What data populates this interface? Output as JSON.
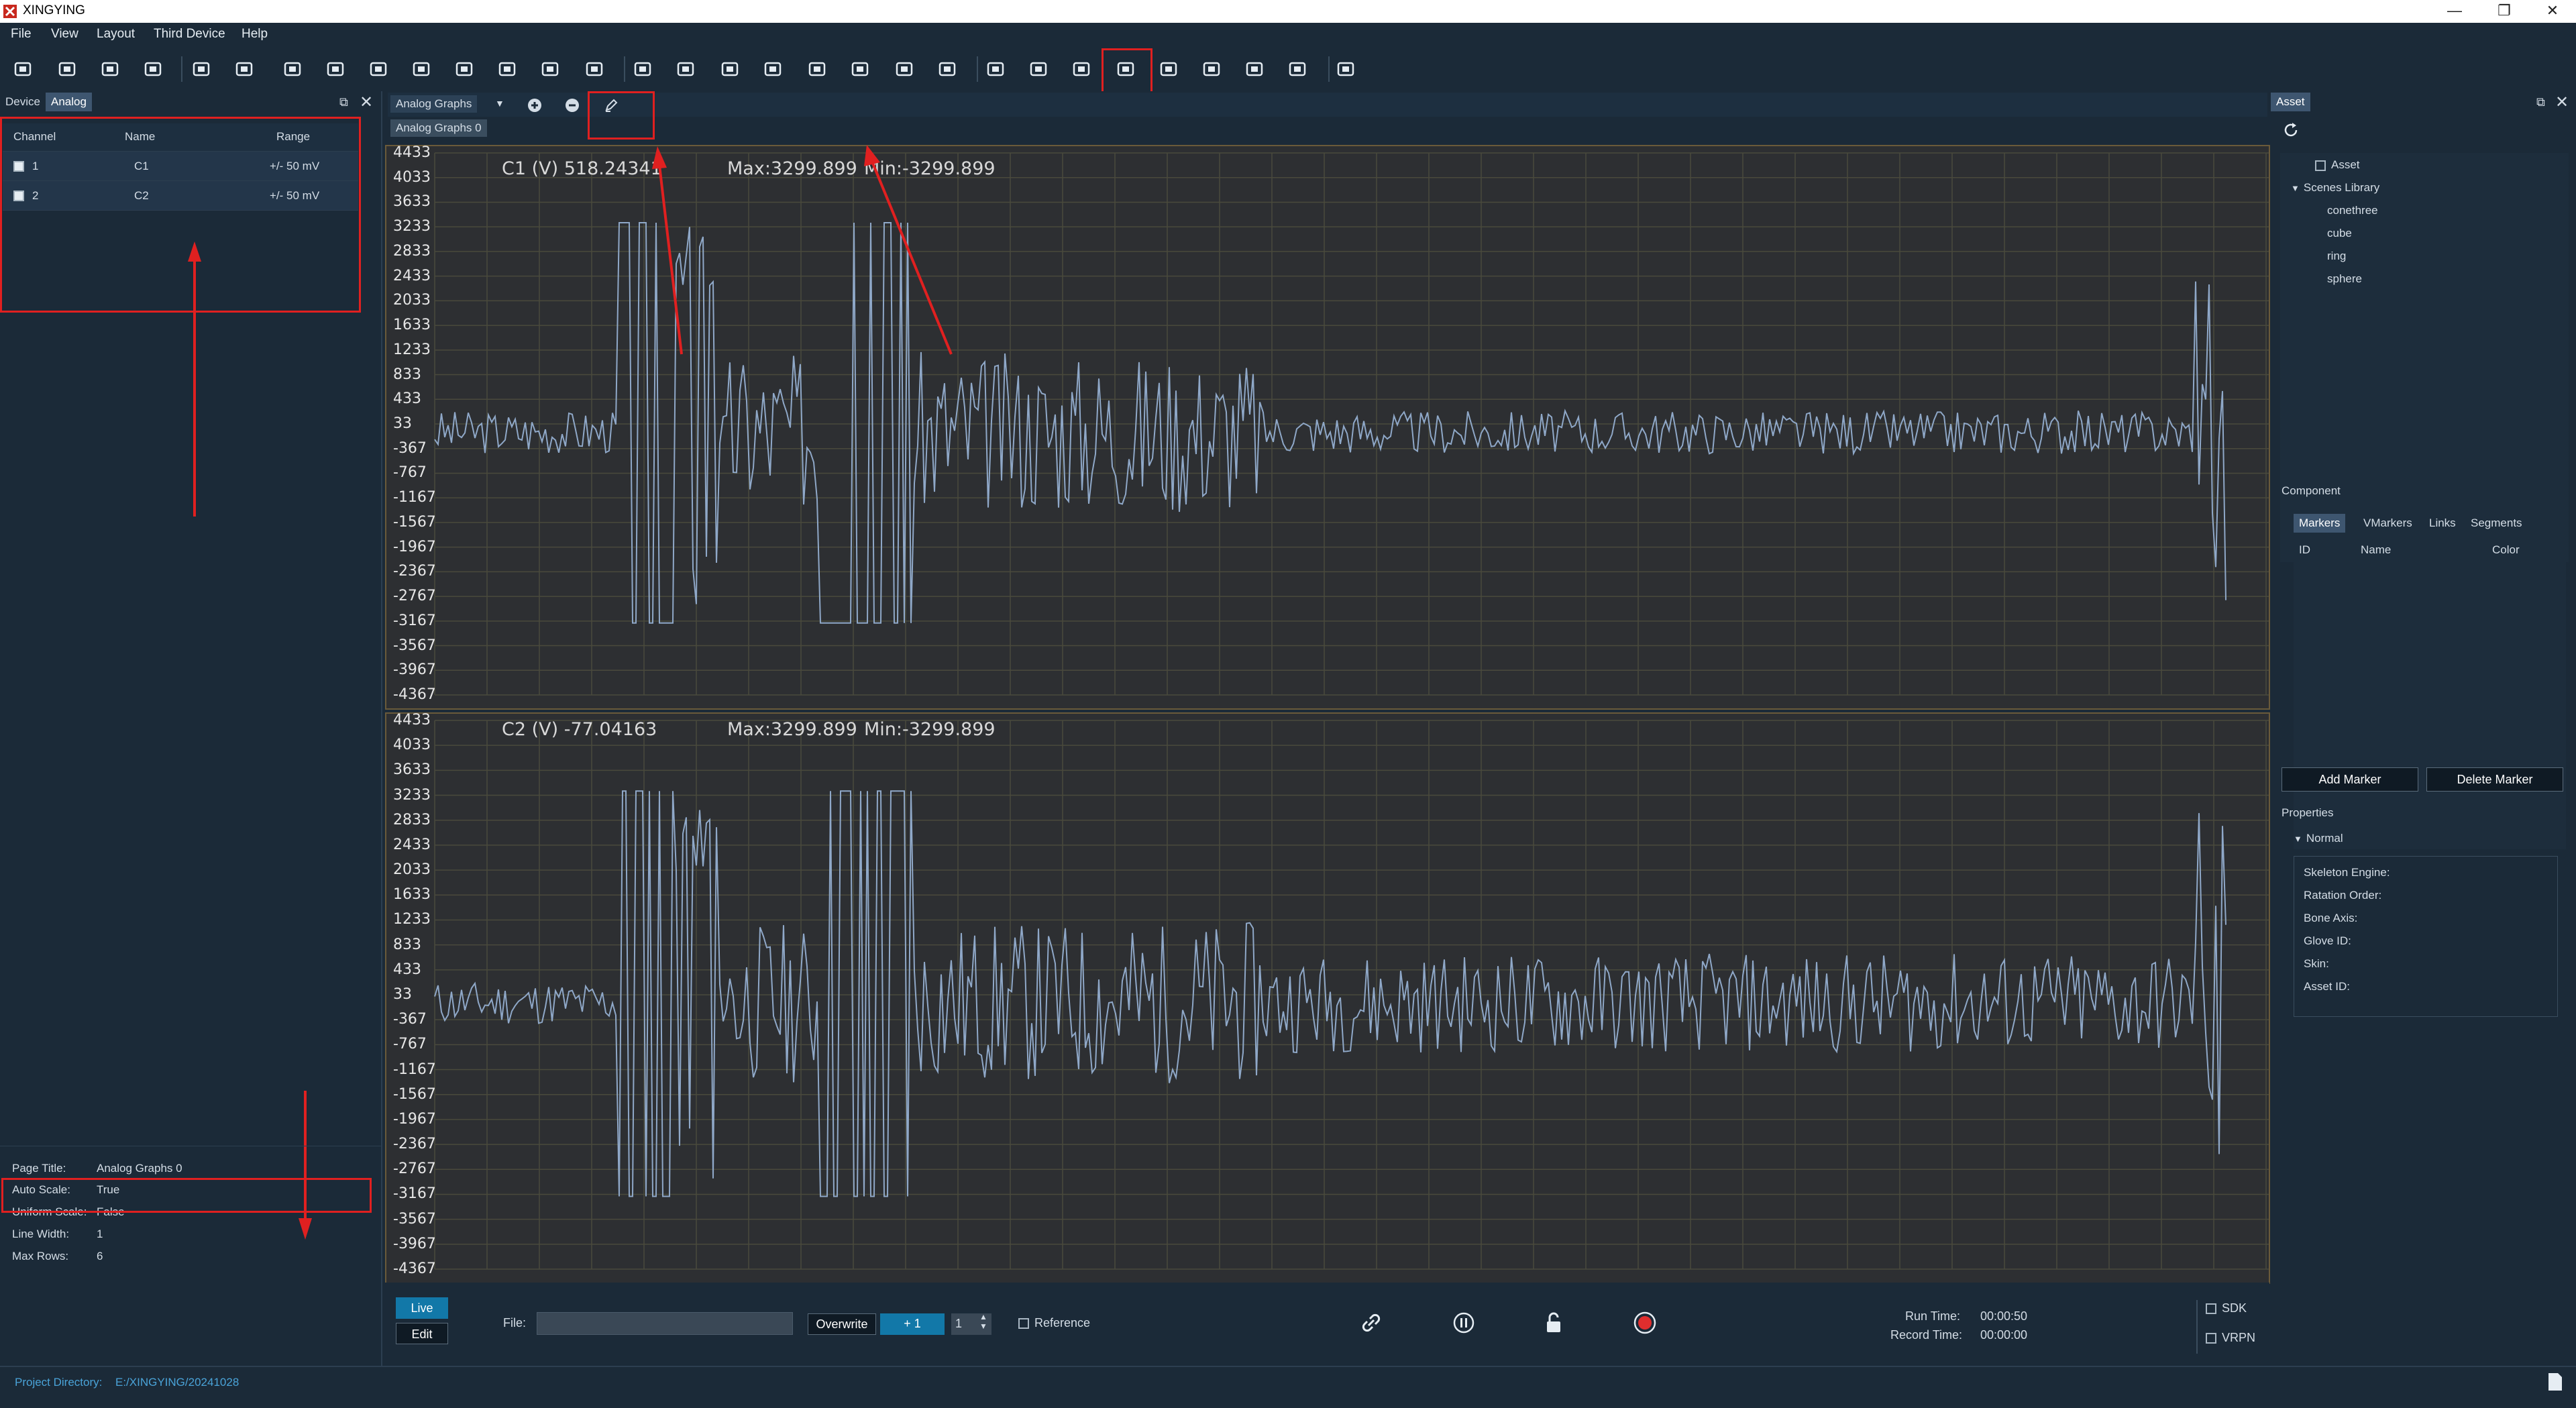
{
  "window": {
    "title": "XINGYING"
  },
  "menu": [
    "File",
    "View",
    "Layout",
    "Third Device",
    "Help"
  ],
  "toolbar_icons": [
    "open-folder-icon",
    "ruler-icon",
    "camera-save-icon",
    "save-icon",
    "eye-off-icon",
    "mirror-icon",
    "video-camera-icon",
    "crop-icon",
    "layout-icon",
    "disk-icon",
    "refresh-icon",
    "layers-icon",
    "camera-view-icon",
    "settings-icon",
    "monitor-1-icon",
    "monitor-2-icon",
    "monitor-3-icon",
    "monitor-4-icon",
    "monitor-5-icon",
    "monitor-6-icon",
    "monitor-7-icon",
    "monitor-8-icon",
    "capture-icon",
    "video-icon",
    "3d-icon",
    "gauge-icon",
    "graph-icon",
    "bar-chart-icon",
    "wm-icon",
    "document-icon",
    "axis-chart-icon"
  ],
  "left_panel": {
    "tabs": [
      "Device",
      "Analog"
    ],
    "active_tab": "Analog",
    "table_headers": [
      "Channel",
      "Name",
      "Range"
    ],
    "rows": [
      {
        "channel": "1",
        "name": "C1",
        "range": "+/- 50 mV"
      },
      {
        "channel": "2",
        "name": "C2",
        "range": "+/- 50 mV"
      }
    ],
    "properties": [
      {
        "key": "Page Title:",
        "value": "Analog Graphs 0"
      },
      {
        "key": "Auto Scale:",
        "value": "True"
      },
      {
        "key": "Uniform Scale:",
        "value": "False"
      },
      {
        "key": "Line Width:",
        "value": "1"
      },
      {
        "key": "Max Rows:",
        "value": "6"
      }
    ]
  },
  "center": {
    "dropdown_label": "Analog Graphs",
    "sub_tab": "Analog Graphs 0",
    "graphs": [
      {
        "channel_label": "C1 (V) 518.24341",
        "max": "Max:3299.899",
        "min": "Min:-3299.899"
      },
      {
        "channel_label": "C2 (V) -77.04163",
        "max": "Max:3299.899",
        "min": "Min:-3299.899"
      }
    ],
    "y_ticks": [
      "4433",
      "4033",
      "3633",
      "3233",
      "2833",
      "2433",
      "2033",
      "1633",
      "1233",
      "833",
      "433",
      "33",
      "-367",
      "-767",
      "-1167",
      "-1567",
      "-1967",
      "-2367",
      "-2767",
      "-3167",
      "-3567",
      "-3967",
      "-4367"
    ]
  },
  "bottom": {
    "live_label": "Live",
    "edit_label": "Edit",
    "file_label": "File:",
    "file_value": "",
    "overwrite_label": "Overwrite",
    "plus_one_label": "+ 1",
    "spin_value": "1",
    "reference_label": "Reference",
    "run_time_label": "Run Time:",
    "run_time_value": "00:00:50",
    "record_time_label": "Record Time:",
    "record_time_value": "00:00:00",
    "sdk_label": "SDK",
    "vrpn_label": "VRPN"
  },
  "right_panel": {
    "tab": "Asset",
    "tree": {
      "asset_label": "Asset",
      "scenes_label": "Scenes Library",
      "items": [
        "conethree",
        "cube",
        "ring",
        "sphere"
      ]
    },
    "component_label": "Component",
    "component_tabs": [
      "Markers",
      "VMarkers",
      "Links",
      "Segments"
    ],
    "columns": [
      "ID",
      "Name",
      "Color"
    ],
    "add_marker": "Add Marker",
    "delete_marker": "Delete Marker",
    "properties_label": "Properties",
    "normal_label": "Normal",
    "props": [
      "Skeleton Engine:",
      "Ratation Order:",
      "Bone Axis:",
      "Glove ID:",
      "Skin:",
      "Asset ID:"
    ]
  },
  "status": {
    "project_dir_label": "Project Directory:",
    "project_dir_value": "E:/XINGYING/20241028"
  },
  "colors": {
    "accent": "#4aa3d8",
    "highlight": "#e02020",
    "signal": "#8fa8c8",
    "graph_bg": "#2d2f32",
    "gridline": "#4a4a3c"
  }
}
